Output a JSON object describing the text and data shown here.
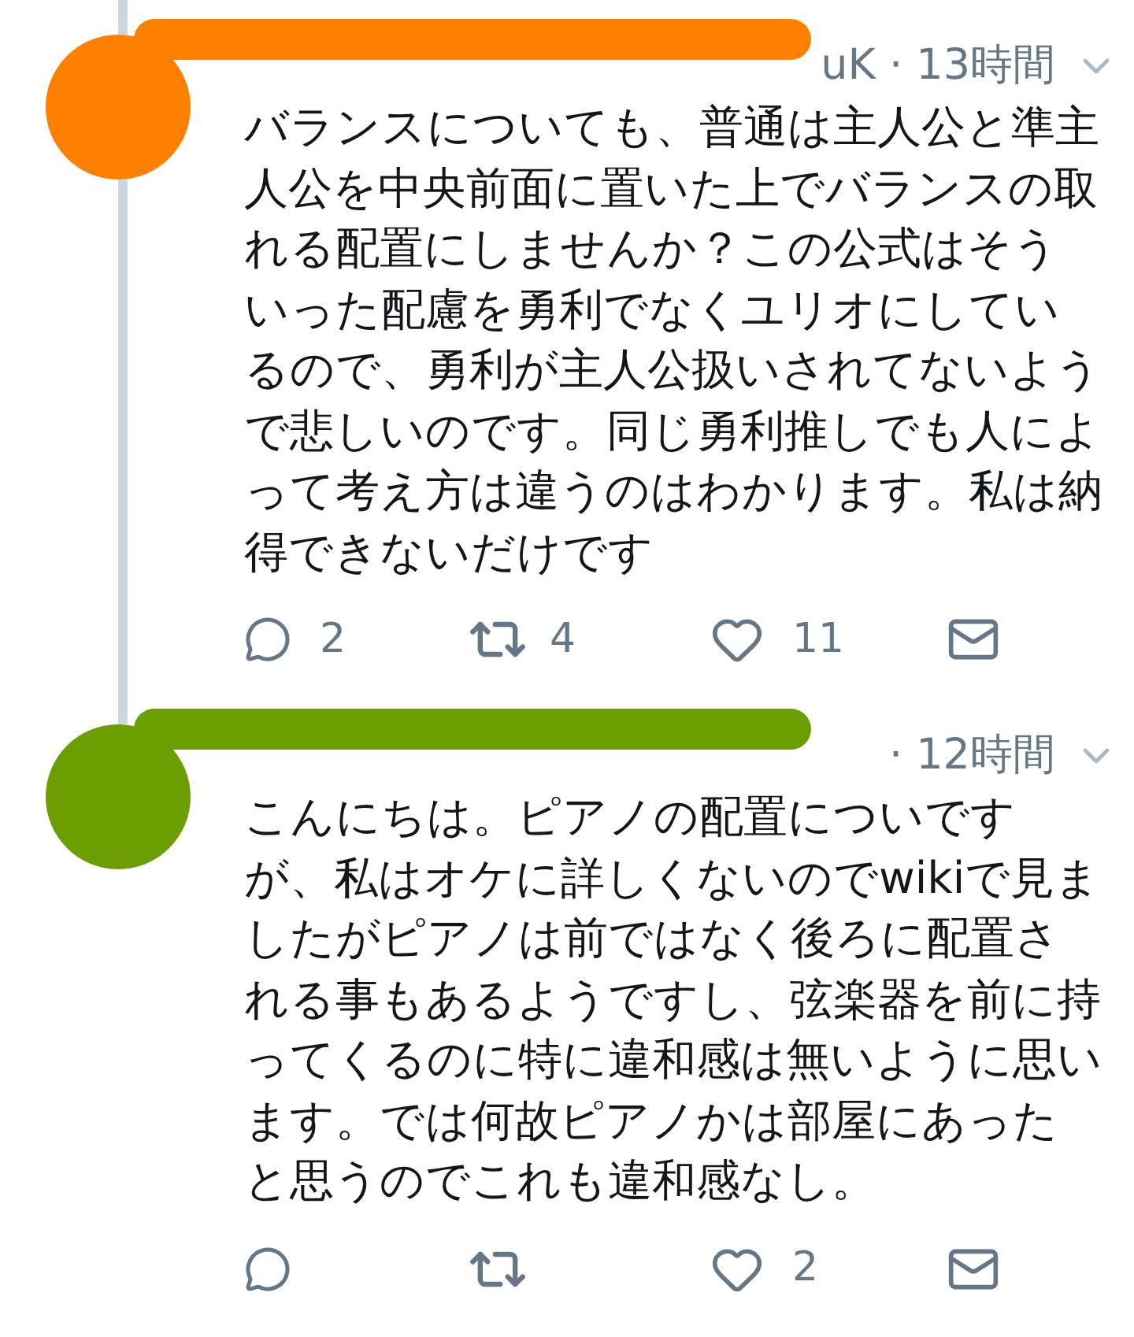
{
  "tweets": [
    {
      "color": "#ff8000",
      "header": "uK · 13時間",
      "thread_above": true,
      "thread_below": true,
      "text": "バランスについても、普通は主人公と準主人公を中央前面に置いた上でバランスの取れる配置にしませんか？この公式はそういった配慮を勇利でなくユリオにしているので、勇利が主人公扱いされてないようで悲しいのです。同じ勇利推しでも人によって考え方は違うのはわかります。私は納得できないだけです",
      "replies": "2",
      "retweets": "4",
      "likes": "11"
    },
    {
      "color": "#6b9e00",
      "header": "· 12時間",
      "thread_above": true,
      "text": "こんにちは。ピアノの配置についですが、私はオケに詳しくないのでwikiで見ましたがピアノは前ではなく後ろに配置される事もあるようですし、弦楽器を前に持ってくるのに特に違和感は無いように思います。では何故ピアノかは部屋にあったと思うのでこれも違和感なし。",
      "likes": "2"
    }
  ]
}
